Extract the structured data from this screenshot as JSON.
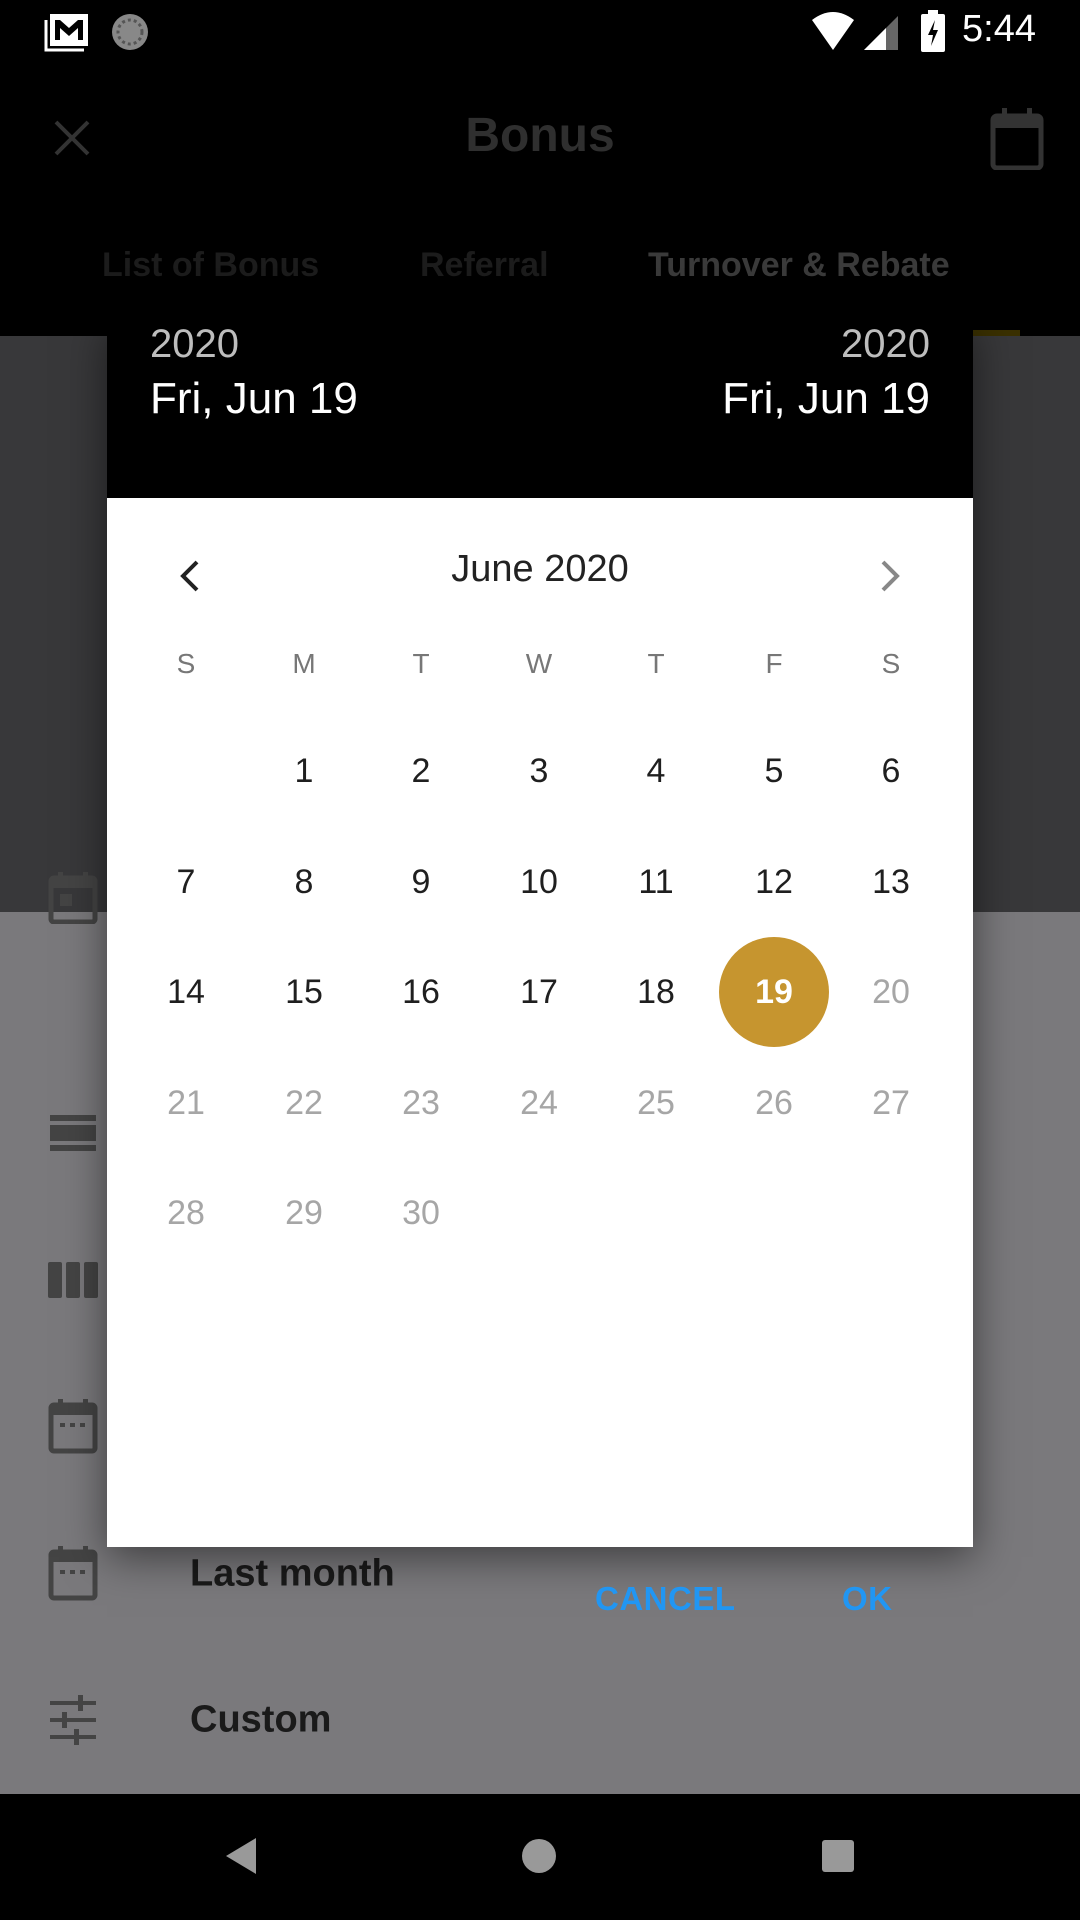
{
  "status_bar": {
    "time": "5:44",
    "icons": [
      "gmail-icon",
      "sync-icon",
      "wifi-icon",
      "signal-icon",
      "battery-charging-icon"
    ]
  },
  "app_bar": {
    "title": "Bonus",
    "close_icon": "close-icon",
    "calendar_icon": "calendar-icon"
  },
  "tabs": [
    {
      "label": "List of Bonus"
    },
    {
      "label": "Referral"
    },
    {
      "label": "Turnover & Rebate",
      "active": true
    }
  ],
  "background_list": [
    {
      "label": "",
      "icon": "calendar-today-icon"
    },
    {
      "label": "",
      "icon": "view-stream-icon"
    },
    {
      "label": "",
      "icon": "view-column-icon"
    },
    {
      "label": "",
      "icon": "calendar-dots-icon"
    },
    {
      "label": "Last month",
      "icon": "calendar-dots-icon"
    },
    {
      "label": "Custom",
      "icon": "tune-icon"
    }
  ],
  "date_picker": {
    "start": {
      "year": "2020",
      "date": "Fri, Jun 19"
    },
    "end": {
      "year": "2020",
      "date": "Fri, Jun 19"
    },
    "month_label": "June 2020",
    "weekdays": [
      "S",
      "M",
      "T",
      "W",
      "T",
      "F",
      "S"
    ],
    "first_weekday_index": 1,
    "days_in_month": 30,
    "selected_day": 19,
    "last_enabled_day": 19,
    "cancel_label": "CANCEL",
    "ok_label": "OK",
    "colors": {
      "selected": "#c6952f",
      "button": "#2196f3"
    }
  },
  "nav_bar": {
    "icons": [
      "back-icon",
      "home-icon",
      "recents-icon"
    ]
  }
}
